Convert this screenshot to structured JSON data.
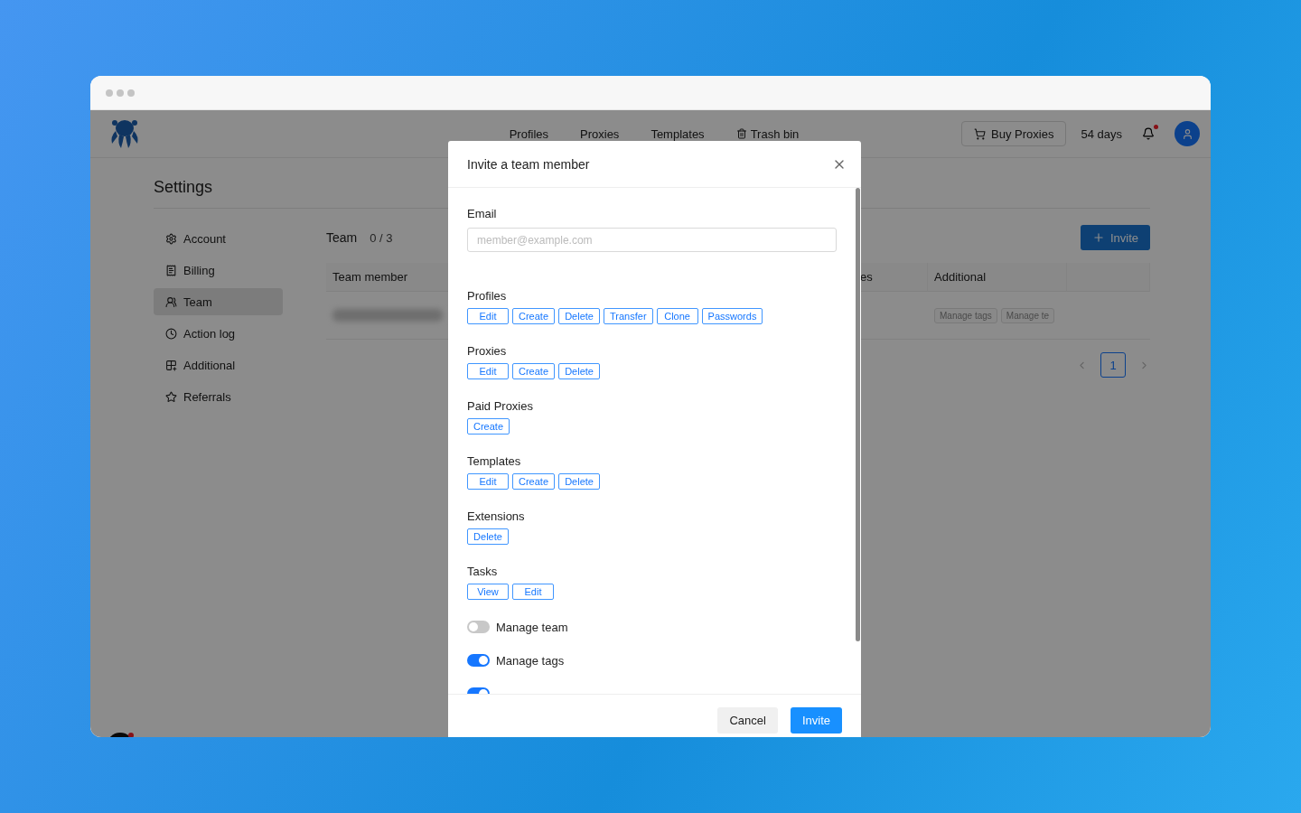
{
  "header": {
    "nav": [
      {
        "label": "Profiles"
      },
      {
        "label": "Proxies"
      },
      {
        "label": "Templates"
      },
      {
        "label": "Trash bin"
      }
    ],
    "buy_button": "Buy Proxies",
    "days": "54 days",
    "unread_notifications": true
  },
  "settings": {
    "title": "Settings",
    "menu": [
      {
        "label": "Account",
        "selected": false
      },
      {
        "label": "Billing",
        "selected": false
      },
      {
        "label": "Team",
        "selected": true
      },
      {
        "label": "Action log",
        "selected": false
      },
      {
        "label": "Additional",
        "selected": false
      },
      {
        "label": "Referrals",
        "selected": false
      }
    ]
  },
  "team": {
    "title": "Team",
    "count": "0 / 3",
    "invite_button": "Invite",
    "columns": [
      "Team member",
      "es",
      "Additional"
    ],
    "row_tags": [
      "Manage tags",
      "Manage te"
    ],
    "pages": [
      {
        "label": "1",
        "selected": true
      }
    ]
  },
  "modal": {
    "title": "Invite a team member",
    "email": {
      "label": "Email",
      "placeholder": "member@example.com"
    },
    "groups": [
      {
        "label": "Profiles",
        "actions": [
          "Edit",
          "Create",
          "Delete",
          "Transfer",
          "Clone",
          "Passwords"
        ]
      },
      {
        "label": "Proxies",
        "actions": [
          "Edit",
          "Create",
          "Delete"
        ]
      },
      {
        "label": "Paid Proxies",
        "actions": [
          "Create"
        ]
      },
      {
        "label": "Templates",
        "actions": [
          "Edit",
          "Create",
          "Delete"
        ]
      },
      {
        "label": "Extensions",
        "actions": [
          "Delete"
        ]
      },
      {
        "label": "Tasks",
        "actions": [
          "View",
          "Edit"
        ]
      }
    ],
    "toggles": [
      {
        "label": "Manage team",
        "on": false
      },
      {
        "label": "Manage tags",
        "on": true
      },
      {
        "on": true
      }
    ],
    "cancel": "Cancel",
    "submit": "Invite"
  }
}
